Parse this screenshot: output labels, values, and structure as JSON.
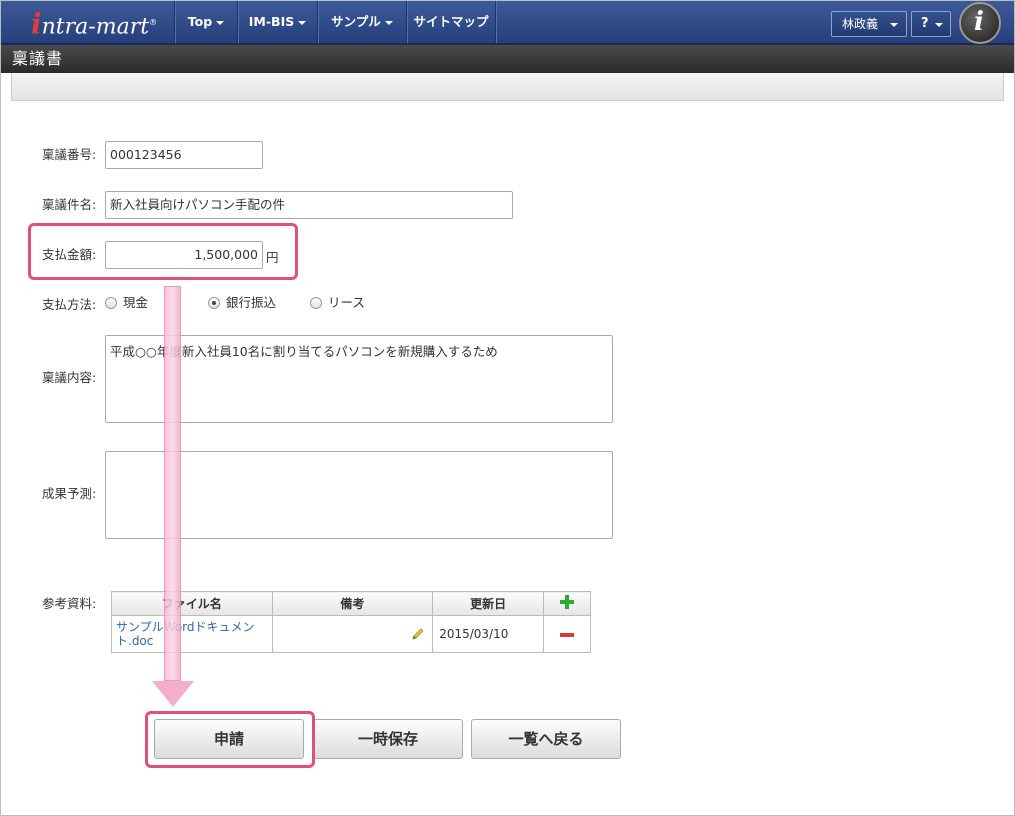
{
  "nav": {
    "logo": "intra-mart",
    "items": [
      {
        "label": "Top"
      },
      {
        "label": "IM-BIS"
      },
      {
        "label": "サンプル"
      },
      {
        "label": "サイトマップ"
      }
    ],
    "user": "林政義",
    "help": "?",
    "badge": "i"
  },
  "page": {
    "title": "稟議書"
  },
  "form": {
    "number_label": "稟議番号:",
    "number_value": "000123456",
    "subject_label": "稟議件名:",
    "subject_value": "新入社員向けパソコン手配の件",
    "amount_label": "支払金額:",
    "amount_value": "1,500,000",
    "amount_unit": "円",
    "method_label": "支払方法:",
    "methods": [
      {
        "label": "現金",
        "selected": false
      },
      {
        "label": "銀行振込",
        "selected": true
      },
      {
        "label": "リース",
        "selected": false
      }
    ],
    "content_label": "稟議内容:",
    "content_value": "平成○○年度新入社員10名に割り当てるパソコンを新規購入するため",
    "forecast_label": "成果予測:",
    "forecast_value": "",
    "reference_label": "参考資料:"
  },
  "attachments": {
    "headers": [
      "ファイル名",
      "備考",
      "更新日"
    ],
    "rows": [
      {
        "file": "サンプルWordドキュメント.doc",
        "note": "",
        "date": "2015/03/10"
      }
    ]
  },
  "buttons": {
    "apply": "申請",
    "save": "一時保存",
    "back": "一覧へ戻る"
  },
  "colors": {
    "nav_bg": "#2e4a8a",
    "highlight": "#e0507a",
    "arrow": "#f2a5c6"
  }
}
